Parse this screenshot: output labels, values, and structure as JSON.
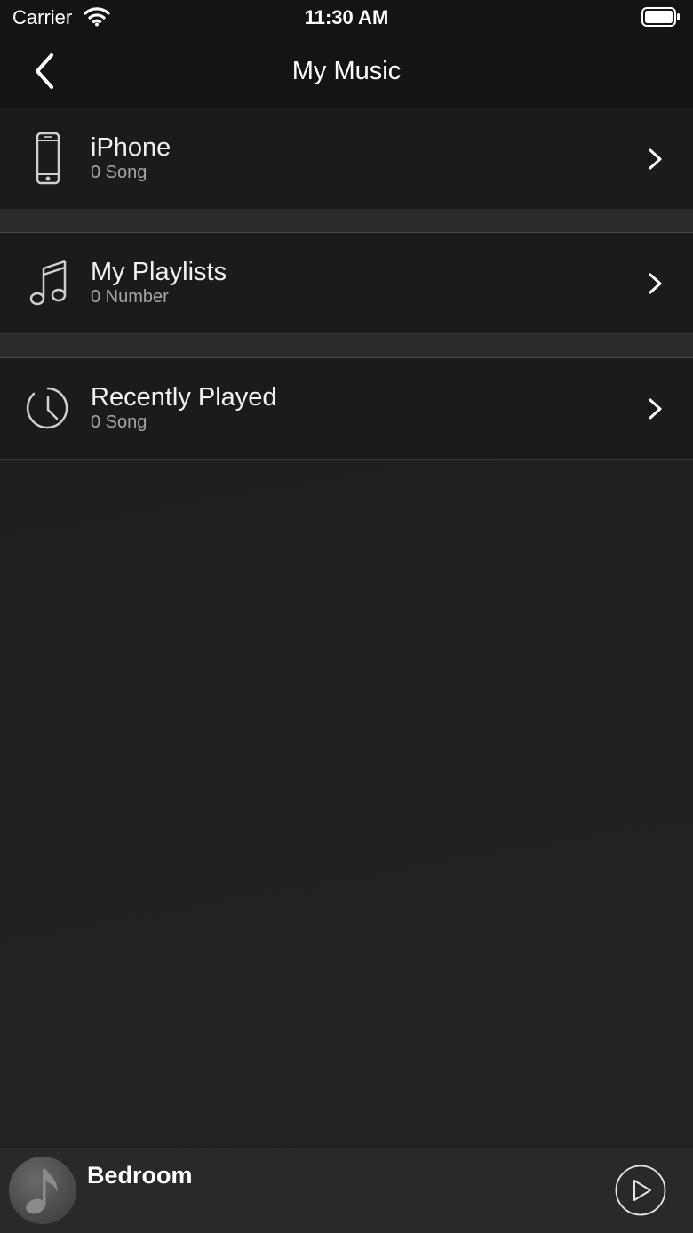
{
  "status_bar": {
    "carrier": "Carrier",
    "time": "11:30 AM",
    "wifi_icon": "wifi-icon",
    "battery_icon": "battery-icon"
  },
  "nav": {
    "title": "My Music",
    "back_icon": "chevron-left-icon"
  },
  "rows": [
    {
      "title": "iPhone",
      "subtitle": "0 Song",
      "icon": "phone-icon"
    },
    {
      "title": "My Playlists",
      "subtitle": "0 Number",
      "icon": "music-note-icon"
    },
    {
      "title": "Recently Played",
      "subtitle": "0 Song",
      "icon": "clock-icon"
    }
  ],
  "player": {
    "device": "Bedroom",
    "album_icon": "music-note-icon",
    "play_icon": "play-icon"
  },
  "colors": {
    "background": "#1e1e1e",
    "row": "#1b1b1b",
    "separator": "#2b2b2b",
    "player": "#292929",
    "text_primary": "#ffffff",
    "text_secondary": "#a6a6a6"
  }
}
